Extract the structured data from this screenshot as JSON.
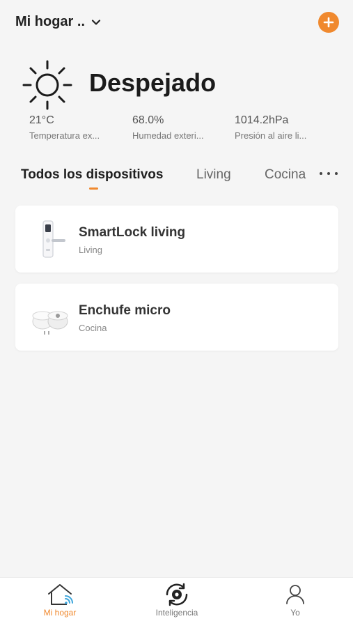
{
  "header": {
    "home_name": "Mi hogar ..",
    "colors": {
      "accent": "#f0892e"
    }
  },
  "weather": {
    "condition": "Despejado",
    "icon": "sun-icon",
    "stats": [
      {
        "value": "21°C",
        "label": "Temperatura ex..."
      },
      {
        "value": "68.0%",
        "label": "Humedad exteri..."
      },
      {
        "value": "1014.2hPa",
        "label": "Presión al aire li..."
      }
    ]
  },
  "tabs": [
    {
      "label": "Todos los dispositivos",
      "active": true
    },
    {
      "label": "Living",
      "active": false
    },
    {
      "label": "Cocina",
      "active": false
    }
  ],
  "devices": [
    {
      "name": "SmartLock living",
      "room": "Living",
      "icon": "smart-lock-icon"
    },
    {
      "name": "Enchufe micro",
      "room": "Cocina",
      "icon": "smart-plug-icon"
    }
  ],
  "tabbar": [
    {
      "label": "Mi hogar",
      "icon": "home-icon",
      "active": true
    },
    {
      "label": "Inteligencia",
      "icon": "smart-scene-icon",
      "active": false
    },
    {
      "label": "Yo",
      "icon": "profile-icon",
      "active": false
    }
  ]
}
